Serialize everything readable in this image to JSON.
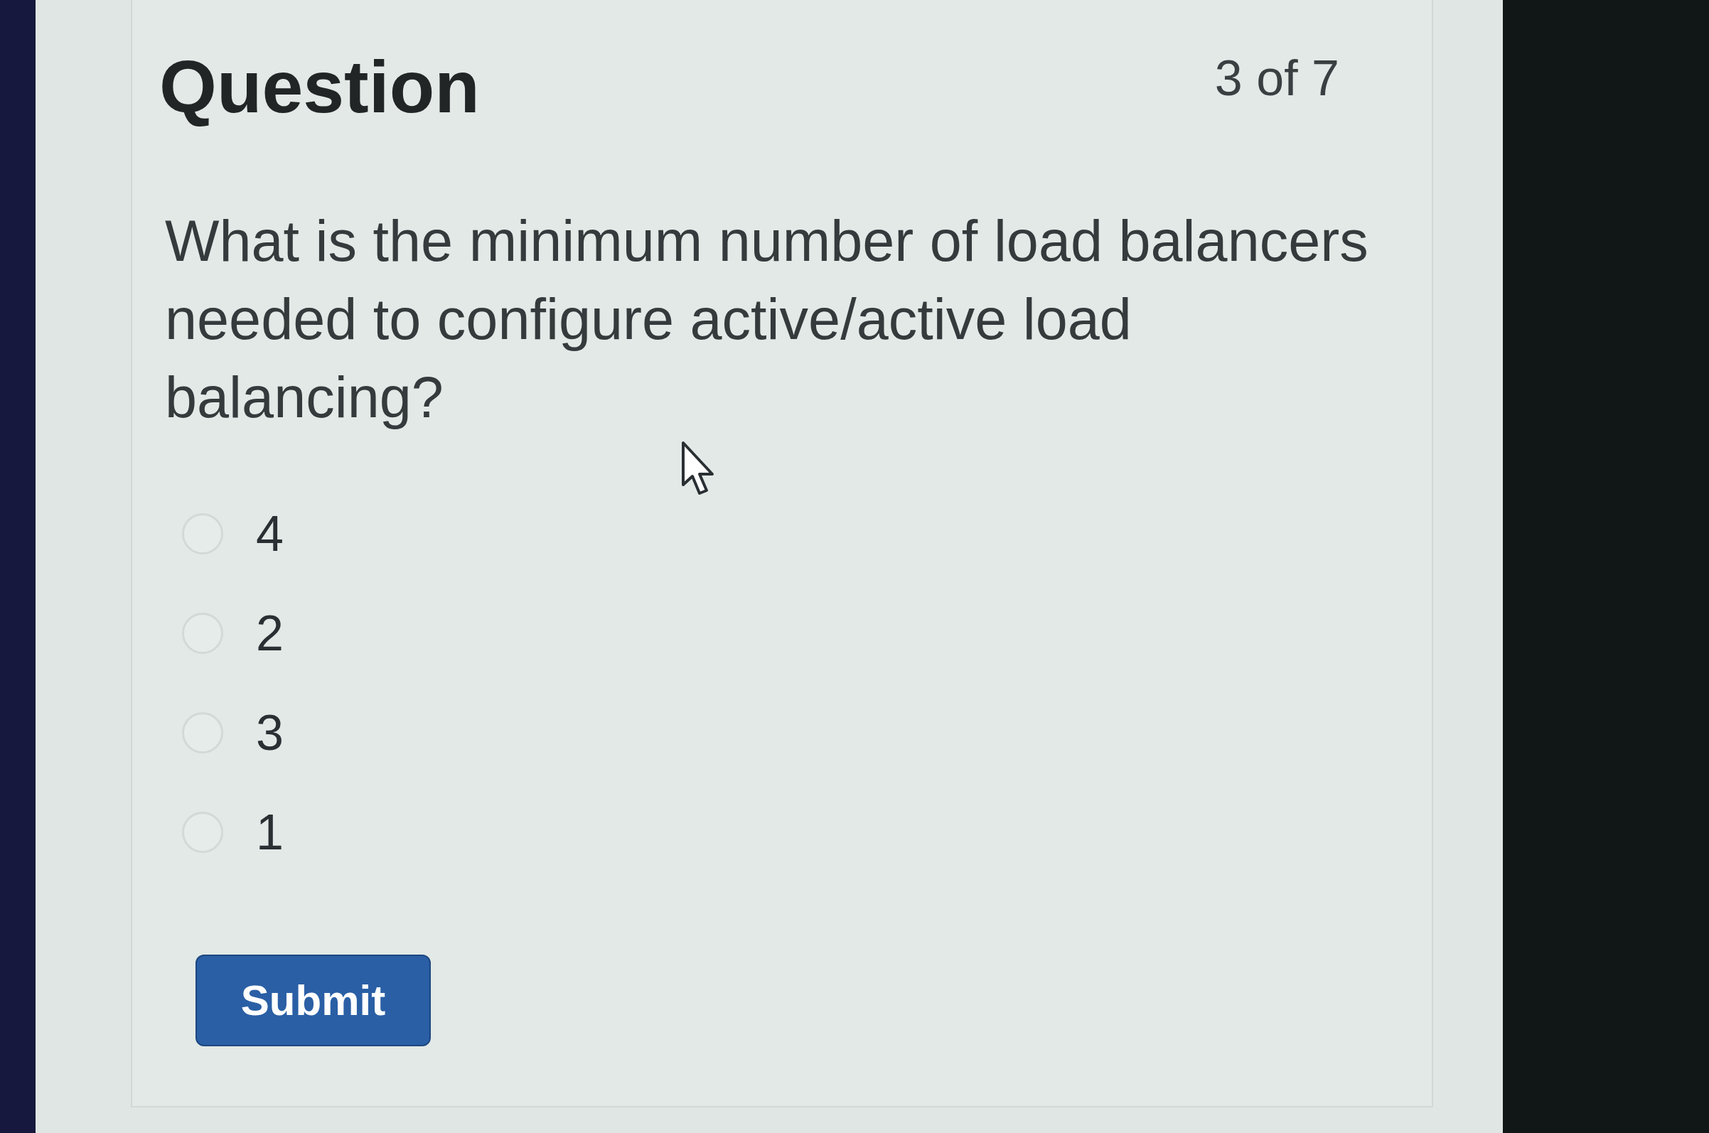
{
  "header": {
    "title": "Question",
    "progress": "3 of 7"
  },
  "question": {
    "text": "What is the minimum number of load balancers needed to configure active/active load balancing?"
  },
  "options": [
    {
      "label": "4",
      "selected": false
    },
    {
      "label": "2",
      "selected": false
    },
    {
      "label": "3",
      "selected": false
    },
    {
      "label": "1",
      "selected": false
    }
  ],
  "submit": {
    "label": "Submit"
  }
}
